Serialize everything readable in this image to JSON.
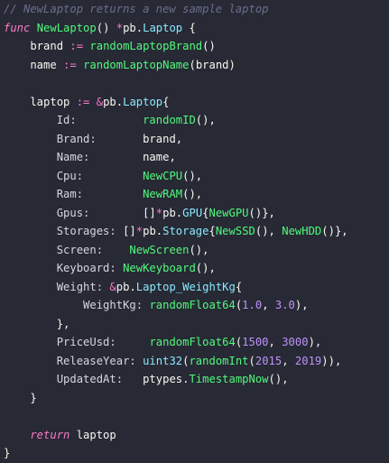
{
  "editor": {
    "theme_colors": {
      "background": "#272935",
      "comment": "#6b6f8a",
      "keyword": "#ff79c6",
      "function": "#50fa7b",
      "type": "#8be9fd",
      "number": "#bd93f9",
      "text": "#f8f8f2"
    },
    "lines": [
      [
        [
          "comment",
          "// NewLaptop returns a new sample laptop"
        ]
      ],
      [
        [
          "keyword",
          "func "
        ],
        [
          "func",
          "NewLaptop"
        ],
        [
          "plain",
          "() "
        ],
        [
          "op",
          "*"
        ],
        [
          "plain",
          "pb."
        ],
        [
          "type",
          "Laptop"
        ],
        [
          "plain",
          " {"
        ]
      ],
      [
        [
          "plain",
          "    brand "
        ],
        [
          "op",
          ":="
        ],
        [
          "plain",
          " "
        ],
        [
          "func",
          "randomLaptopBrand"
        ],
        [
          "plain",
          "()"
        ]
      ],
      [
        [
          "plain",
          "    name "
        ],
        [
          "op",
          ":="
        ],
        [
          "plain",
          " "
        ],
        [
          "func",
          "randomLaptopName"
        ],
        [
          "plain",
          "(brand)"
        ]
      ],
      [
        [
          "plain",
          ""
        ]
      ],
      [
        [
          "plain",
          "    laptop "
        ],
        [
          "op",
          ":="
        ],
        [
          "plain",
          " "
        ],
        [
          "op",
          "&"
        ],
        [
          "plain",
          "pb."
        ],
        [
          "type",
          "Laptop"
        ],
        [
          "plain",
          "{"
        ]
      ],
      [
        [
          "field",
          "        Id:          "
        ],
        [
          "func",
          "randomID"
        ],
        [
          "plain",
          "(),"
        ]
      ],
      [
        [
          "field",
          "        Brand:       "
        ],
        [
          "plain",
          "brand,"
        ]
      ],
      [
        [
          "field",
          "        Name:        "
        ],
        [
          "plain",
          "name,"
        ]
      ],
      [
        [
          "field",
          "        Cpu:         "
        ],
        [
          "func",
          "NewCPU"
        ],
        [
          "plain",
          "(),"
        ]
      ],
      [
        [
          "field",
          "        Ram:         "
        ],
        [
          "func",
          "NewRAM"
        ],
        [
          "plain",
          "(),"
        ]
      ],
      [
        [
          "field",
          "        Gpus:        "
        ],
        [
          "plain",
          "[]"
        ],
        [
          "op",
          "*"
        ],
        [
          "plain",
          "pb."
        ],
        [
          "type",
          "GPU"
        ],
        [
          "plain",
          "{"
        ],
        [
          "func",
          "NewGPU"
        ],
        [
          "plain",
          "()},"
        ]
      ],
      [
        [
          "field",
          "        Storages: "
        ],
        [
          "plain",
          "[]"
        ],
        [
          "op",
          "*"
        ],
        [
          "plain",
          "pb."
        ],
        [
          "type",
          "Storage"
        ],
        [
          "plain",
          "{"
        ],
        [
          "func",
          "NewSSD"
        ],
        [
          "plain",
          "(), "
        ],
        [
          "func",
          "NewHDD"
        ],
        [
          "plain",
          "()},"
        ]
      ],
      [
        [
          "field",
          "        Screen:    "
        ],
        [
          "func",
          "NewScreen"
        ],
        [
          "plain",
          "(),"
        ]
      ],
      [
        [
          "field",
          "        Keyboard: "
        ],
        [
          "func",
          "NewKeyboard"
        ],
        [
          "plain",
          "(),"
        ]
      ],
      [
        [
          "field",
          "        Weight: "
        ],
        [
          "op",
          "&"
        ],
        [
          "plain",
          "pb."
        ],
        [
          "type",
          "Laptop_WeightKg"
        ],
        [
          "plain",
          "{"
        ]
      ],
      [
        [
          "field",
          "            WeightKg: "
        ],
        [
          "func",
          "randomFloat64"
        ],
        [
          "plain",
          "("
        ],
        [
          "number",
          "1.0"
        ],
        [
          "plain",
          ", "
        ],
        [
          "number",
          "3.0"
        ],
        [
          "plain",
          "),"
        ]
      ],
      [
        [
          "plain",
          "        },"
        ]
      ],
      [
        [
          "field",
          "        PriceUsd:     "
        ],
        [
          "func",
          "randomFloat64"
        ],
        [
          "plain",
          "("
        ],
        [
          "number",
          "1500"
        ],
        [
          "plain",
          ", "
        ],
        [
          "number",
          "3000"
        ],
        [
          "plain",
          "),"
        ]
      ],
      [
        [
          "field",
          "        ReleaseYear: "
        ],
        [
          "type",
          "uint32"
        ],
        [
          "plain",
          "("
        ],
        [
          "func",
          "randomInt"
        ],
        [
          "plain",
          "("
        ],
        [
          "number",
          "2015"
        ],
        [
          "plain",
          ", "
        ],
        [
          "number",
          "2019"
        ],
        [
          "plain",
          ")),"
        ]
      ],
      [
        [
          "field",
          "        UpdatedAt:   "
        ],
        [
          "plain",
          "ptypes."
        ],
        [
          "func",
          "TimestampNow"
        ],
        [
          "plain",
          "(),"
        ]
      ],
      [
        [
          "plain",
          "    }"
        ]
      ],
      [
        [
          "plain",
          ""
        ]
      ],
      [
        [
          "keyword",
          "    return"
        ],
        [
          "plain",
          " laptop"
        ]
      ],
      [
        [
          "plain",
          "}"
        ]
      ]
    ]
  }
}
